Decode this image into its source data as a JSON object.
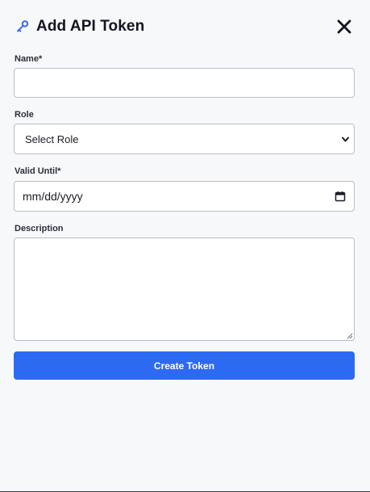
{
  "header": {
    "title": "Add API Token",
    "icon": "key-icon",
    "close_icon": "close-icon"
  },
  "form": {
    "name_label": "Name*",
    "name_value": "",
    "role_label": "Role",
    "role_selected": "Select Role",
    "valid_until_label": "Valid Until*",
    "valid_until_value": "mm/dd/yyyy",
    "description_label": "Description",
    "description_value": "",
    "submit_label": "Create Token"
  },
  "colors": {
    "accent": "#2d6af2",
    "icon_blue": "#3b6fd8",
    "title": "#111522",
    "background": "#f7f8fa"
  }
}
